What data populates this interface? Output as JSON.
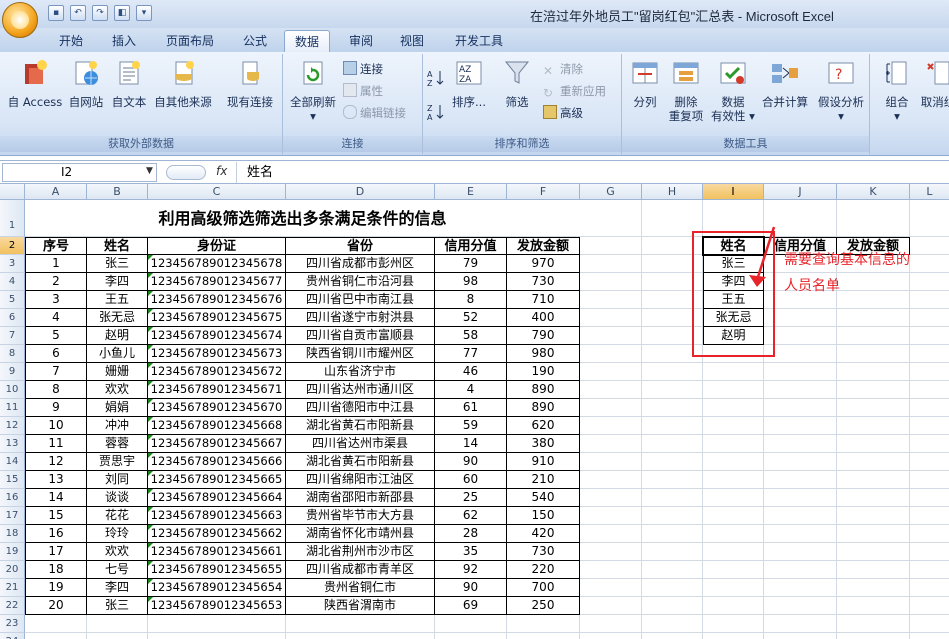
{
  "window": {
    "title": "在涪过年外地员工\"留岗红包\"汇总表 - Microsoft Excel"
  },
  "tabs": [
    "开始",
    "插入",
    "页面布局",
    "公式",
    "数据",
    "审阅",
    "视图",
    "开发工具"
  ],
  "active_tab": "数据",
  "ribbon": {
    "get_external": {
      "title": "获取外部数据",
      "access": "自 Access",
      "web": "自网站",
      "text": "自文本",
      "other": "自其他来源",
      "existing": "现有连接"
    },
    "connections": {
      "title": "连接",
      "refresh_line1": "全部刷新",
      "connections": "连接",
      "properties": "属性",
      "edit_links": "编辑链接"
    },
    "sort_filter": {
      "title": "排序和筛选",
      "sort": "排序...",
      "filter": "筛选",
      "clear": "清除",
      "reapply": "重新应用",
      "advanced": "高级"
    },
    "data_tools": {
      "title": "数据工具",
      "text_to_cols": "分列",
      "remove_dup_1": "删除",
      "remove_dup_2": "重复项",
      "validation_1": "数据",
      "validation_2": "有效性",
      "consolidate": "合并计算",
      "whatif": "假设分析"
    },
    "outline": {
      "group": "组合",
      "ungroup": "取消组"
    }
  },
  "formula_bar": {
    "name_box": "I2",
    "fx": "fx",
    "content": "姓名"
  },
  "columns": [
    "A",
    "B",
    "C",
    "D",
    "E",
    "F",
    "G",
    "H",
    "I",
    "J",
    "K",
    "L"
  ],
  "selected_column": "I",
  "selected_row": "2",
  "sheet_title": "利用高级筛选筛选出多条满足条件的信息",
  "table_headers": [
    "序号",
    "姓名",
    "身份证",
    "省份",
    "信用分值",
    "发放金额"
  ],
  "rows": [
    [
      "1",
      "张三",
      "123456789012345678",
      "四川省成都市彭州区",
      "79",
      "970"
    ],
    [
      "2",
      "李四",
      "123456789012345677",
      "贵州省铜仁市沿河县",
      "98",
      "730"
    ],
    [
      "3",
      "王五",
      "123456789012345676",
      "四川省巴中市南江县",
      "8",
      "710"
    ],
    [
      "4",
      "张无忌",
      "123456789012345675",
      "四川省遂宁市射洪县",
      "52",
      "400"
    ],
    [
      "5",
      "赵明",
      "123456789012345674",
      "四川省自贡市富顺县",
      "58",
      "790"
    ],
    [
      "6",
      "小鱼儿",
      "123456789012345673",
      "陕西省铜川市耀州区",
      "77",
      "980"
    ],
    [
      "7",
      "姗姗",
      "123456789012345672",
      "山东省济宁市",
      "46",
      "190"
    ],
    [
      "8",
      "欢欢",
      "123456789012345671",
      "四川省达州市通川区",
      "4",
      "890"
    ],
    [
      "9",
      "娟娟",
      "123456789012345670",
      "四川省德阳市中江县",
      "61",
      "890"
    ],
    [
      "10",
      "冲冲",
      "123456789012345668",
      "湖北省黄石市阳新县",
      "59",
      "620"
    ],
    [
      "11",
      "蓉蓉",
      "123456789012345667",
      "四川省达州市渠县",
      "14",
      "380"
    ],
    [
      "12",
      "贾思宇",
      "123456789012345666",
      "湖北省黄石市阳新县",
      "90",
      "910"
    ],
    [
      "13",
      "刘同",
      "123456789012345665",
      "四川省绵阳市江油区",
      "60",
      "210"
    ],
    [
      "14",
      "谈谈",
      "123456789012345664",
      "湖南省邵阳市新邵县",
      "25",
      "540"
    ],
    [
      "15",
      "花花",
      "123456789012345663",
      "贵州省毕节市大方县",
      "62",
      "150"
    ],
    [
      "16",
      "玲玲",
      "123456789012345662",
      "湖南省怀化市靖州县",
      "28",
      "420"
    ],
    [
      "17",
      "欢欢",
      "123456789012345661",
      "湖北省荆州市沙市区",
      "35",
      "730"
    ],
    [
      "18",
      "七号",
      "123456789012345655",
      "四川省成都市青羊区",
      "92",
      "220"
    ],
    [
      "19",
      "李四",
      "123456789012345654",
      "贵州省铜仁市",
      "90",
      "700"
    ],
    [
      "20",
      "张三",
      "123456789012345653",
      "陕西省渭南市",
      "69",
      "250"
    ]
  ],
  "criteria_headers": [
    "姓名",
    "信用分值",
    "发放金额"
  ],
  "criteria_names": [
    "张三",
    "李四",
    "王五",
    "张无忌",
    "赵明"
  ],
  "annotation": {
    "line1": "需要查询基本信息的",
    "line2": "人员名单"
  },
  "colors": {
    "annotation": "#e8242a",
    "ribbon_bg": "#d8e5f6",
    "selected_header": "#f1c15f"
  }
}
